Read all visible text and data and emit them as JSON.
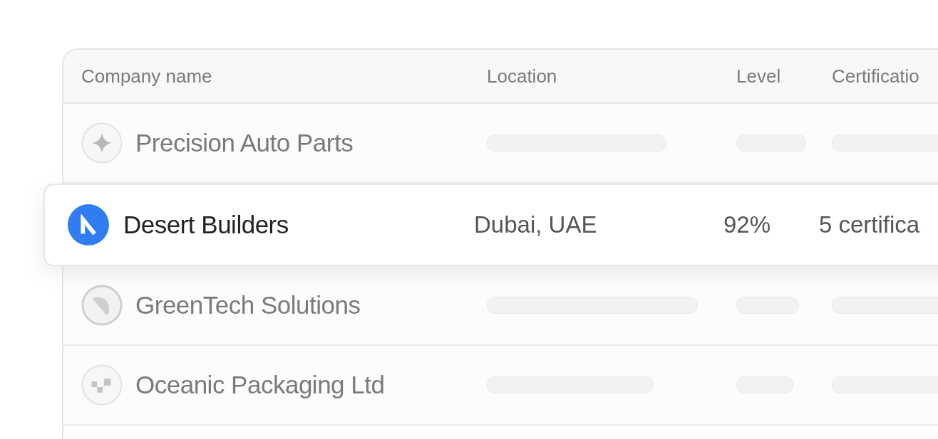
{
  "table": {
    "columns": [
      {
        "label": "Company name"
      },
      {
        "label": "Location"
      },
      {
        "label": "Level"
      },
      {
        "label": "Certificatio"
      }
    ],
    "rows": [
      {
        "name": "Precision Auto Parts",
        "kind": "star",
        "selected": false
      },
      {
        "name": "Desert Builders",
        "kind": "letter",
        "selected": true,
        "location": "Dubai, UAE",
        "level_text": "92%",
        "certifications": "5 certifica"
      },
      {
        "name": "GreenTech Solutions",
        "kind": "leaf",
        "selected": false
      },
      {
        "name": "Oceanic Packaging Ltd",
        "kind": "squares",
        "selected": false
      }
    ]
  }
}
